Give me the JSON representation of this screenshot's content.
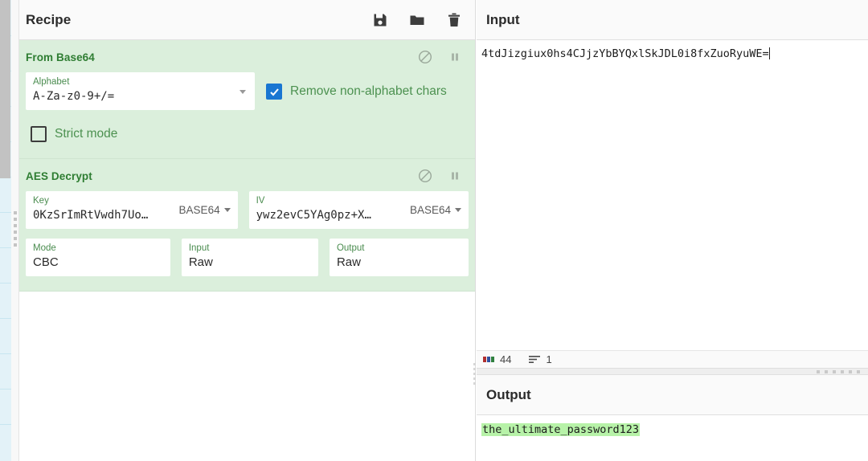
{
  "recipe": {
    "title": "Recipe",
    "toolbar": [
      {
        "name": "save-recipe-button",
        "icon": "save-icon",
        "label": "Save recipe"
      },
      {
        "name": "load-recipe-button",
        "icon": "folder-icon",
        "label": "Load recipe"
      },
      {
        "name": "clear-recipe-button",
        "icon": "trash-icon",
        "label": "Clear recipe"
      }
    ],
    "operations": [
      {
        "name": "From Base64",
        "controls": [
          {
            "icon": "disable-icon",
            "label": "Disable operation"
          },
          {
            "icon": "pause-icon",
            "label": "Set breakpoint"
          }
        ],
        "args": [
          {
            "label": "Alphabet",
            "value": "A-Za-z0-9+/=",
            "type": "select"
          },
          {
            "label": "Remove non-alphabet chars",
            "value": "true",
            "type": "checkbox"
          },
          {
            "label": "Strict mode",
            "value": "false",
            "type": "checkbox"
          }
        ]
      },
      {
        "name": "AES Decrypt",
        "controls": [
          {
            "icon": "disable-icon",
            "label": "Disable operation"
          },
          {
            "icon": "pause-icon",
            "label": "Set breakpoint"
          }
        ],
        "args": [
          {
            "label": "Key",
            "value": "0KzSrImRtVwdh7Uo…",
            "unit": "BASE64",
            "type": "toggle-string"
          },
          {
            "label": "IV",
            "value": "ywz2evC5YAg0pz+X…",
            "unit": "BASE64",
            "type": "toggle-string"
          },
          {
            "label": "Mode",
            "value": "CBC",
            "type": "select"
          },
          {
            "label": "Input",
            "value": "Raw",
            "type": "select"
          },
          {
            "label": "Output",
            "value": "Raw",
            "type": "select"
          }
        ]
      }
    ]
  },
  "input": {
    "title": "Input",
    "value": "4tdJizgiux0hs4CJjzYbBYQxlSkJDL0i8fxZuoRyuWE=",
    "status": {
      "length_icon": "abc-icon",
      "length": "44",
      "lines_icon": "lines-icon",
      "lines": "1"
    }
  },
  "output": {
    "title": "Output",
    "value": "the_ultimate_password123",
    "highlight_color": "#b7f2a8"
  },
  "colors": {
    "operation_background": "#dbefdc",
    "operation_title": "#2e7d32",
    "checkbox_checked": "#1976d2",
    "panel_header": "#fafafa"
  }
}
